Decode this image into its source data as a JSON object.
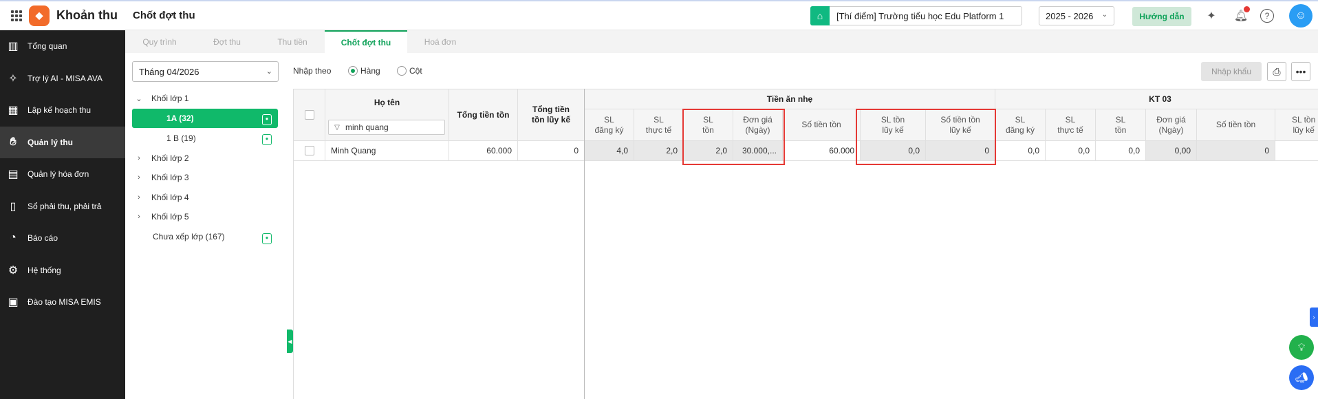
{
  "app": {
    "title": "Khoản thu",
    "page_title": "Chốt đợt thu"
  },
  "header": {
    "school": "[Thí điểm] Trường tiểu học Edu Platform 1",
    "year": "2025 - 2026",
    "guide_label": "Hướng dẫn"
  },
  "sidebar": {
    "items": [
      {
        "label": "Tổng quan",
        "icon": "chart-icon"
      },
      {
        "label": "Trợ lý AI - MISA AVA",
        "icon": "sparkle-icon"
      },
      {
        "label": "Lập kế hoạch thu",
        "icon": "calendar-money-icon"
      },
      {
        "label": "Quản lý thu",
        "icon": "hand-money-icon",
        "active": true
      },
      {
        "label": "Quản lý hóa đơn",
        "icon": "invoice-icon"
      },
      {
        "label": "Sổ phải thu, phải trả",
        "icon": "ledger-icon"
      },
      {
        "label": "Báo cáo",
        "icon": "pie-chart-icon"
      },
      {
        "label": "Hệ thống",
        "icon": "gear-icon"
      },
      {
        "label": "Đào tạo MISA EMIS",
        "icon": "book-icon"
      }
    ]
  },
  "tabs": [
    "Quy trình",
    "Đợt thu",
    "Thu tiền",
    "Chốt đợt thu",
    "Hoá đơn"
  ],
  "filter": {
    "month": "Tháng 04/2026",
    "tree": [
      {
        "label": "Khối lớp 1",
        "expanded": true
      },
      {
        "label": "1A (32)",
        "active": true
      },
      {
        "label": "1 B (19)"
      },
      {
        "label": "Khối lớp 2"
      },
      {
        "label": "Khối lớp 3"
      },
      {
        "label": "Khối lớp 4"
      },
      {
        "label": "Khối lớp 5"
      },
      {
        "label": "Chưa xếp lớp (167)"
      }
    ]
  },
  "options": {
    "input_by": "Nhập theo",
    "row_label": "Hàng",
    "col_label": "Cột",
    "import_label": "Nhập khẩu"
  },
  "table": {
    "headers": {
      "name": "Họ tên",
      "total": "Tổng tiền tồn",
      "total_cum": "Tổng tiền\ntồn lũy kế",
      "group1": "Tiền ăn nhẹ",
      "group2": "KT 03",
      "sub": {
        "sl_dk": "SL\nđăng ký",
        "sl_tt": "SL\nthực tế",
        "sl_ton": "SL\ntồn",
        "don_gia": "Đơn giá\n(Ngày)",
        "so_tien_ton": "Số tiền tồn",
        "sl_ton_lk": "SL tồn\nlũy kế",
        "so_tien_ton_lk": "Số tiền tồn\nlũy kế",
        "sl_ton_short": "SL\ntồn",
        "sl_ton_lk_partial": "SL tồn\nlũy kế"
      }
    },
    "search_value": "minh quang",
    "rows": [
      {
        "name": "Minh Quang",
        "total": "60.000",
        "total_cum": "0",
        "g1": [
          "4,0",
          "2,0",
          "2,0",
          "30.000,...",
          "60.000",
          "0,0",
          "0"
        ],
        "g2": [
          "0,0",
          "0,0",
          "0,0",
          "0,00",
          "0"
        ]
      }
    ]
  },
  "colors": {
    "accent": "#10b96a",
    "highlight": "#e53935",
    "sidebar": "#1f1f1f"
  }
}
